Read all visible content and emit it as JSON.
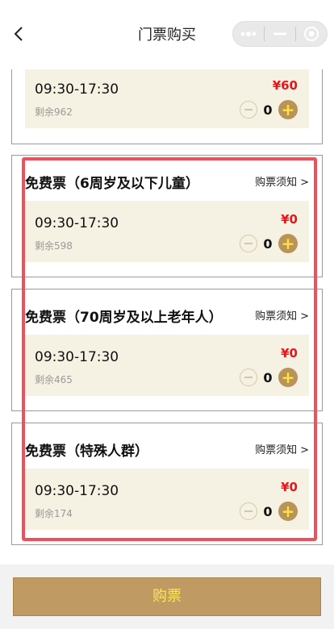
{
  "header": {
    "title": "门票购买",
    "back_icon": "chevron-left-icon",
    "capsule": {
      "more_icon": "more-dots-icon",
      "minimize_icon": "minimize-icon",
      "close_icon": "target-close-icon"
    }
  },
  "tickets": [
    {
      "title": "",
      "notice": "",
      "slot": {
        "time": "09:30-17:30",
        "remaining": "剩余962",
        "price": "¥60",
        "quantity": "0"
      }
    },
    {
      "title": "免费票（6周岁及以下儿童）",
      "notice": "购票须知",
      "slot": {
        "time": "09:30-17:30",
        "remaining": "剩余598",
        "price": "¥0",
        "quantity": "0"
      }
    },
    {
      "title": "免费票（70周岁及以上老年人）",
      "notice": "购票须知",
      "slot": {
        "time": "09:30-17:30",
        "remaining": "剩余465",
        "price": "¥0",
        "quantity": "0"
      }
    },
    {
      "title": "免费票（特殊人群）",
      "notice": "购票须知",
      "slot": {
        "time": "09:30-17:30",
        "remaining": "剩余174",
        "price": "¥0",
        "quantity": "0"
      }
    }
  ],
  "notice_chevron": ">",
  "plus_symbol": "+",
  "buy_button": {
    "label": "购票"
  },
  "colors": {
    "accent": "#bf9a63",
    "price": "#e8161c",
    "slot_bg": "#f5f1e3",
    "highlight": "#f0505a",
    "plus_glyph": "#ffe335"
  }
}
